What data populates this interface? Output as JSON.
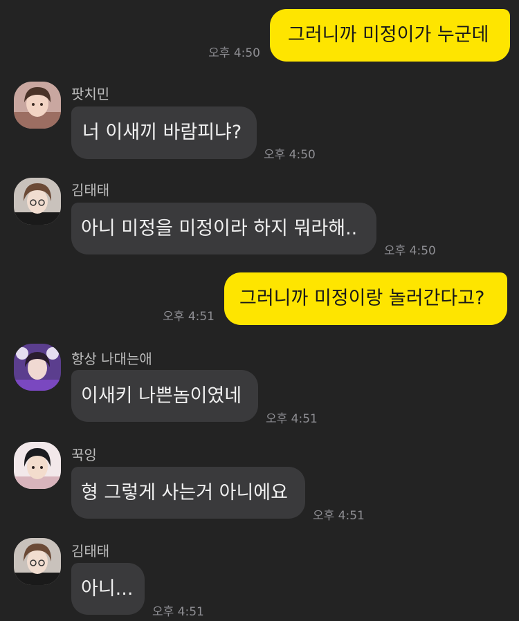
{
  "messages": [
    {
      "type": "out",
      "text": "그러니까 미정이가 누군데",
      "time": "오후 4:50"
    },
    {
      "type": "in",
      "sender": "팟치민",
      "text": "너 이새끼 바람피냐?",
      "time": "오후 4:50",
      "avatar": "avatar-person-icon"
    },
    {
      "type": "in",
      "sender": "김태태",
      "text": "아니 미정을 미정이라 하지 뭐라해..",
      "time": "오후 4:50",
      "avatar": "avatar-person-icon"
    },
    {
      "type": "out",
      "text": "그러니까 미정이랑 놀러간다고?",
      "time": "오후 4:51"
    },
    {
      "type": "in",
      "sender": "항상 나대는애",
      "text": "이새키 나쁜놈이였네",
      "time": "오후 4:51",
      "avatar": "avatar-person-icon"
    },
    {
      "type": "in",
      "sender": "꾹잉",
      "text": "형 그렇게 사는거 아니에요",
      "time": "오후 4:51",
      "avatar": "avatar-person-icon"
    },
    {
      "type": "in",
      "sender": "김태태",
      "text": "아니...",
      "time": "오후 4:51",
      "avatar": "avatar-person-icon"
    }
  ],
  "colors": {
    "background": "#232323",
    "outgoing_bubble": "#FEE500",
    "incoming_bubble": "#3A3A3C",
    "time_text": "#8E8E93",
    "sender_text": "#BDBDBD"
  }
}
